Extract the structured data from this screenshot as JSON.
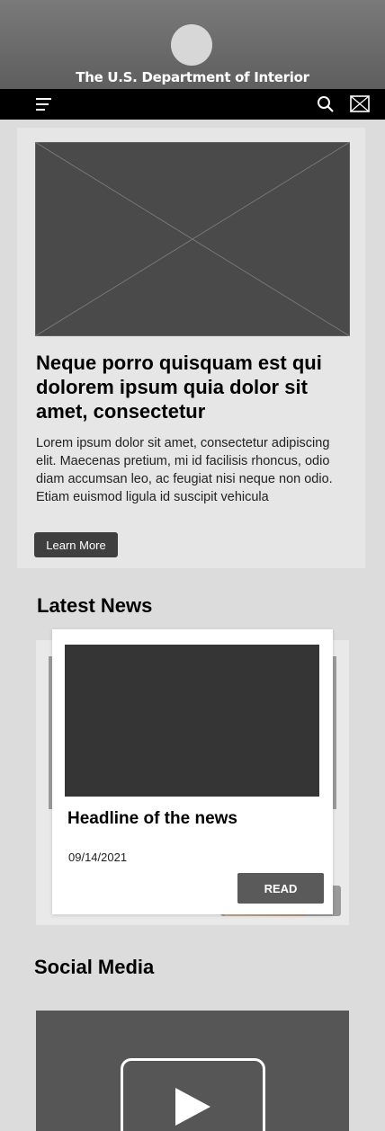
{
  "header": {
    "site_title": "The U.S. Department of Interior"
  },
  "nav": {
    "menu_icon": "hamburger-menu",
    "search_icon": "magnifier",
    "mail_icon": "envelope"
  },
  "hero": {
    "title": "Neque porro quisquam est qui dolorem ipsum quia dolor sit amet, consectetur",
    "text": "Lorem ipsum dolor sit amet, consectetur adipiscing elit. Maecenas pretium, mi id facilisis rhoncus, odio diam accumsan leo, ac feugiat nisi neque non odio. Etiam euismod ligula id suscipit vehicula",
    "button_label": "Learn More"
  },
  "latest_news": {
    "section_title": "Latest News",
    "card": {
      "headline": "Headline of the news",
      "date": "09/14/2021",
      "button_label": "READ"
    }
  },
  "social_media": {
    "section_title": "Social Media",
    "video_icon": "play-button"
  },
  "colors": {
    "header_bg": "#6b6b6b",
    "nav_bg": "#000000",
    "page_bg": "#dcdcdc",
    "button_dark": "#3f3f3f"
  }
}
